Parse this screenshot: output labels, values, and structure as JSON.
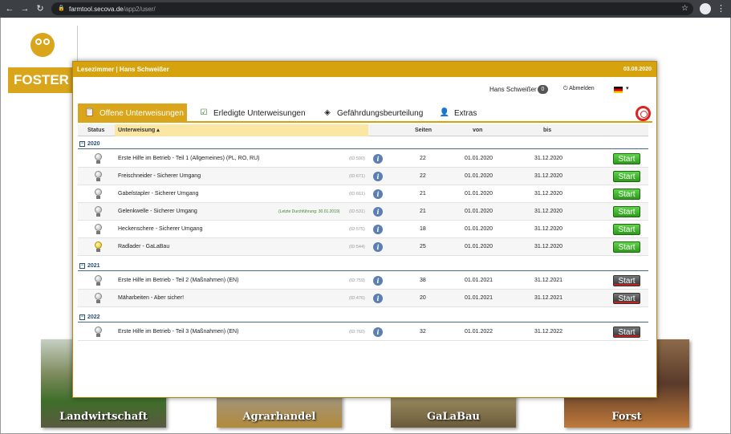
{
  "browser": {
    "url_host": "farmtool.secova.de",
    "url_path": "/app2/user/",
    "back_icon": "arrow-left-icon",
    "forward_icon": "arrow-right-icon",
    "reload_icon": "reload-icon"
  },
  "background": {
    "logo_text": "FOSTER",
    "tiles": [
      "Landwirtschaft",
      "Agrarhandel",
      "GaLaBau",
      "Forst"
    ]
  },
  "modal": {
    "title": "Lesezimmer | Hans Schweißer",
    "date": "03.08.2020",
    "user": {
      "name": "Hans Schweißer",
      "badge": "0",
      "logout_label": "Abmelden"
    },
    "tabs": [
      {
        "label": "Offene Unterweisungen",
        "active": true
      },
      {
        "label": "Erledigte Unterweisungen",
        "active": false
      },
      {
        "label": "Gefährdungsbeurteilung",
        "active": false
      },
      {
        "label": "Extras",
        "active": false
      }
    ],
    "columns": {
      "status": "Status",
      "unterweisung": "Unterweisung ▴",
      "seiten": "Seiten",
      "von": "von",
      "bis": "bis"
    },
    "groups": [
      {
        "year": "2020",
        "rows": [
          {
            "title": "Erste Hilfe im Betrieb - Teil 1 (Allgemeines) (PL, RO, RU)",
            "note": "",
            "id": "(ID:590)",
            "pages": "22",
            "from": "01.01.2020",
            "to": "31.12.2020",
            "bulb_on": false,
            "start": "Start",
            "start_enabled": true
          },
          {
            "title": "Freischneider - Sicherer Umgang",
            "note": "",
            "id": "(ID:671)",
            "pages": "22",
            "from": "01.01.2020",
            "to": "31.12.2020",
            "bulb_on": false,
            "start": "Start",
            "start_enabled": true
          },
          {
            "title": "Gabelstapler - Sicherer Umgang",
            "note": "",
            "id": "(ID:661)",
            "pages": "21",
            "from": "01.01.2020",
            "to": "31.12.2020",
            "bulb_on": false,
            "start": "Start",
            "start_enabled": true
          },
          {
            "title": "Gelenkwelle - Sicherer Umgang",
            "note": "(Letzte Durchführung: 30.01.2019)",
            "id": "(ID:531)",
            "pages": "21",
            "from": "01.01.2020",
            "to": "31.12.2020",
            "bulb_on": false,
            "start": "Start",
            "start_enabled": true
          },
          {
            "title": "Heckenschere - Sicherer Umgang",
            "note": "",
            "id": "(ID:575)",
            "pages": "18",
            "from": "01.01.2020",
            "to": "31.12.2020",
            "bulb_on": false,
            "start": "Start",
            "start_enabled": true
          },
          {
            "title": "Radlader - GaLaBau",
            "note": "",
            "id": "(ID:544)",
            "pages": "25",
            "from": "01.01.2020",
            "to": "31.12.2020",
            "bulb_on": true,
            "start": "Start",
            "start_enabled": true
          }
        ]
      },
      {
        "year": "2021",
        "rows": [
          {
            "title": "Erste Hilfe im Betrieb - Teil 2 (Maßnahmen) (EN)",
            "note": "",
            "id": "(ID:759)",
            "pages": "38",
            "from": "01.01.2021",
            "to": "31.12.2021",
            "bulb_on": false,
            "start": "Start",
            "start_enabled": false
          },
          {
            "title": "Mäharbeiten - Aber sicher!",
            "note": "",
            "id": "(ID:476)",
            "pages": "20",
            "from": "01.01.2021",
            "to": "31.12.2021",
            "bulb_on": false,
            "start": "Start",
            "start_enabled": false
          }
        ]
      },
      {
        "year": "2022",
        "rows": [
          {
            "title": "Erste Hilfe im Betrieb - Teil 3 (Maßnahmen) (EN)",
            "note": "",
            "id": "(ID:760)",
            "pages": "32",
            "from": "01.01.2022",
            "to": "31.12.2022",
            "bulb_on": false,
            "start": "Start",
            "start_enabled": false
          }
        ]
      }
    ]
  },
  "colors": {
    "accent": "#d6a20e",
    "start_green": "#2f9a1d",
    "start_disabled": "#333333",
    "year_blue": "#2a4f7c"
  }
}
